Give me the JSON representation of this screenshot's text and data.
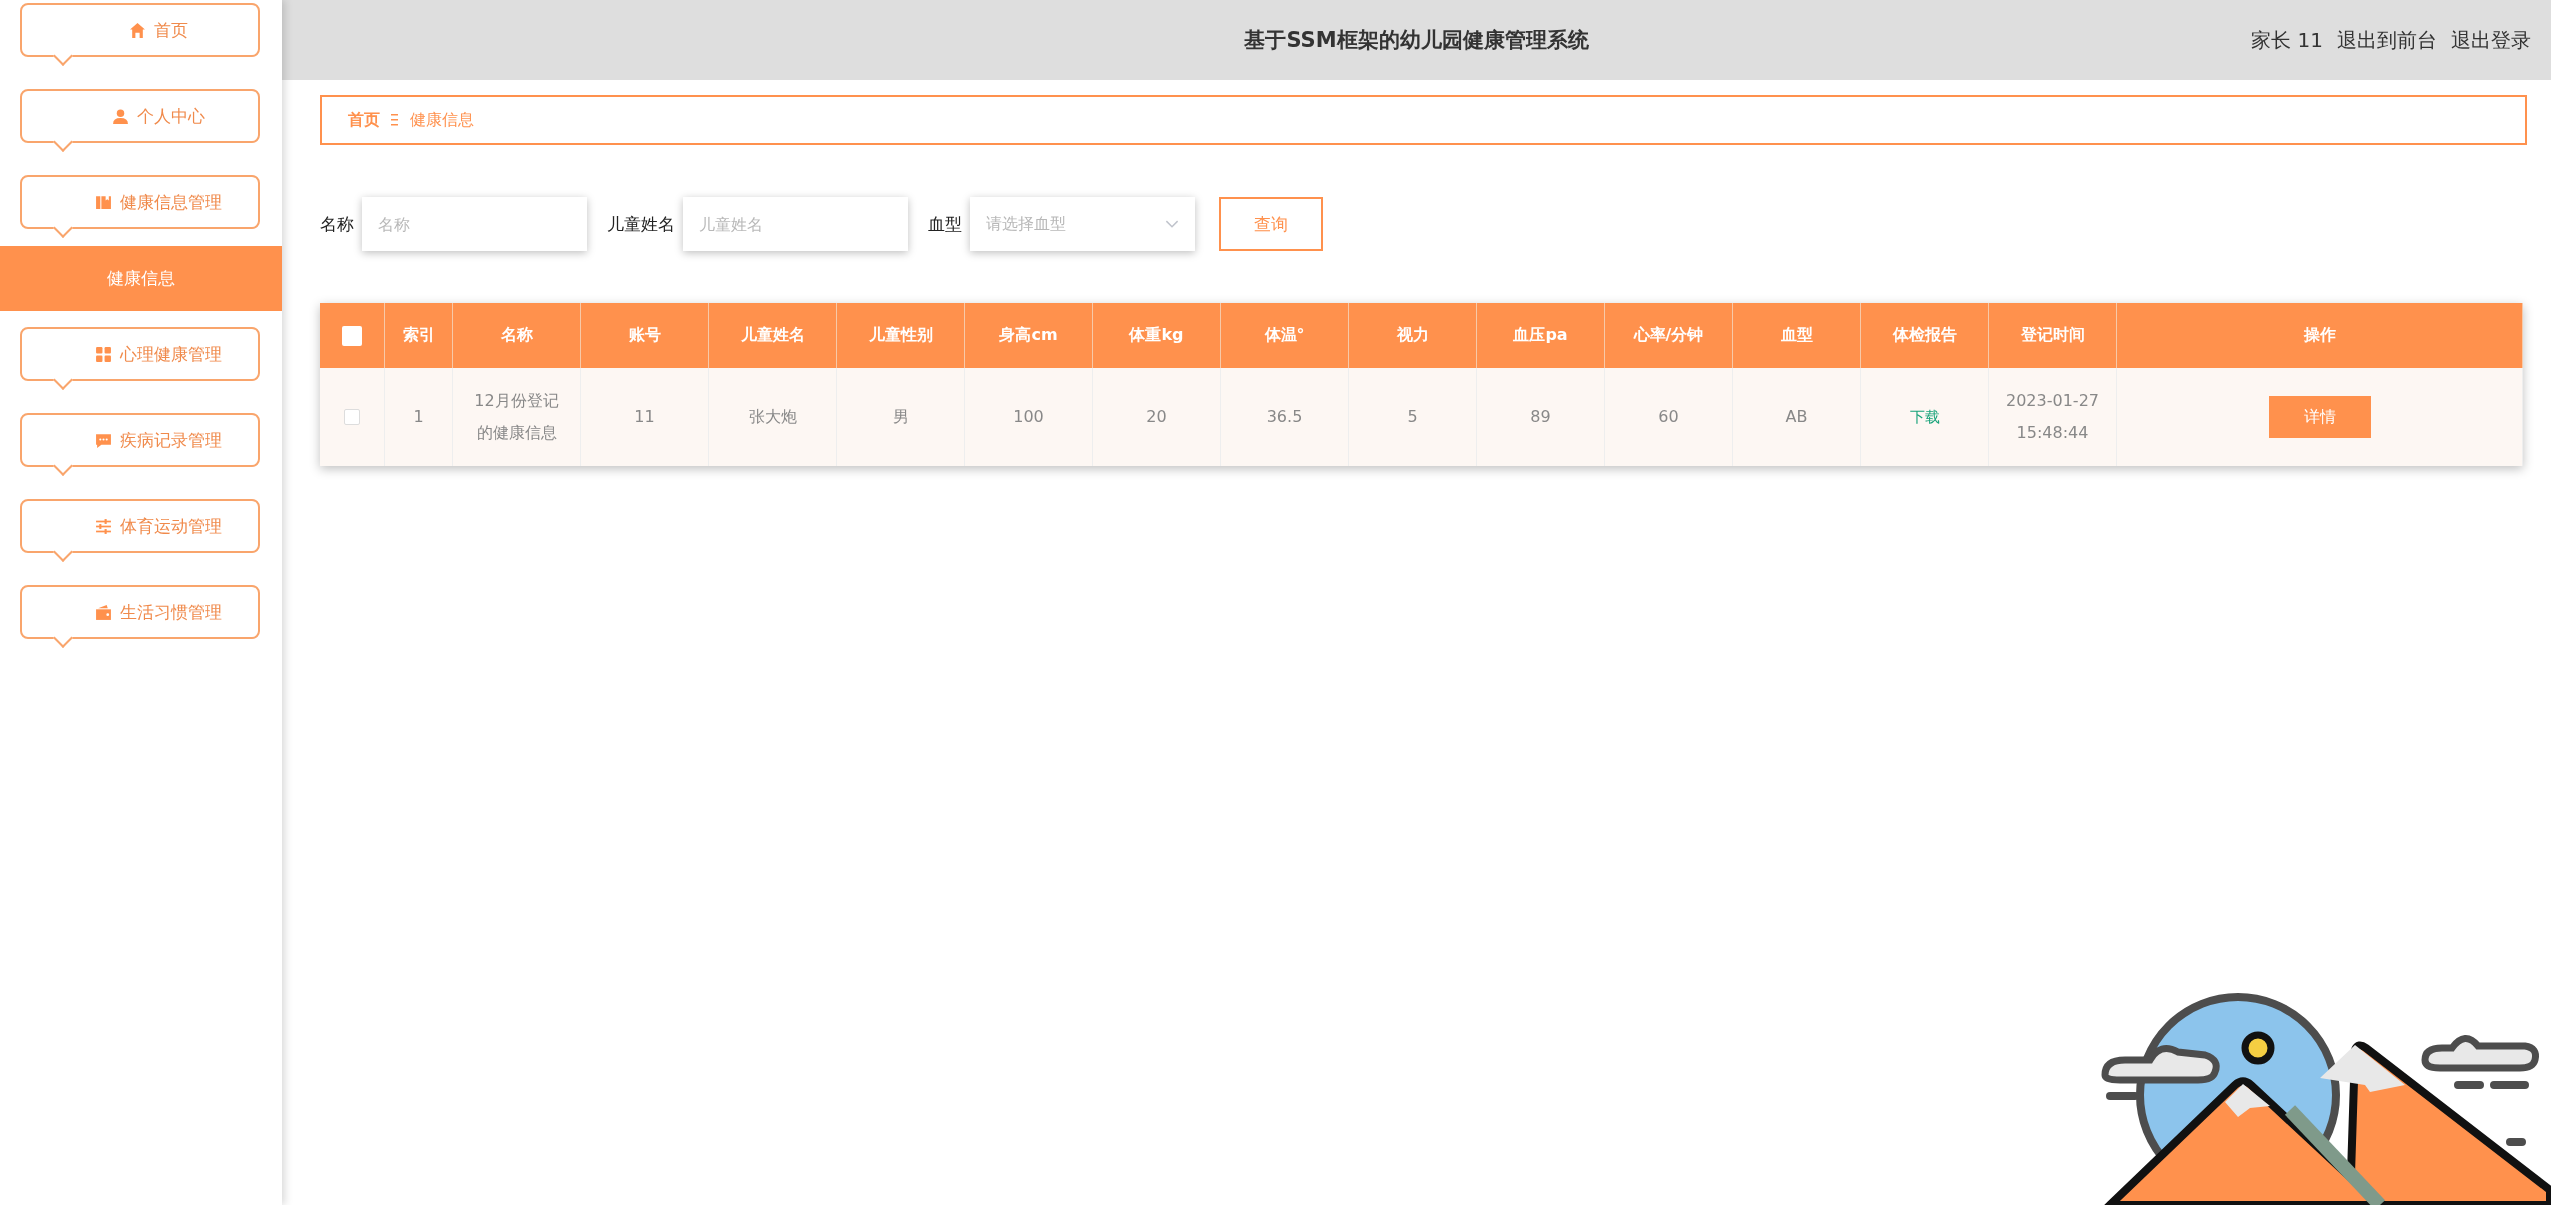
{
  "sidebar": {
    "items": [
      {
        "label": "首页",
        "kind": "menu",
        "selected": false
      },
      {
        "label": "个人中心",
        "kind": "menu",
        "selected": false
      },
      {
        "label": "健康信息管理",
        "kind": "menu",
        "selected": false
      },
      {
        "label": "健康信息",
        "kind": "sub",
        "selected": true
      },
      {
        "label": "心理健康管理",
        "kind": "menu",
        "selected": false
      },
      {
        "label": "疾病记录管理",
        "kind": "menu",
        "selected": false
      },
      {
        "label": "体育运动管理",
        "kind": "menu",
        "selected": false
      },
      {
        "label": "生活习惯管理",
        "kind": "menu",
        "selected": false
      }
    ]
  },
  "header": {
    "title": "基于SSM框架的幼儿园健康管理系统",
    "user": "家长 11",
    "links": [
      "退出到前台",
      "退出登录"
    ]
  },
  "breadcrumb": [
    "首页",
    "健康信息"
  ],
  "search": {
    "fields": [
      {
        "label": "名称",
        "placeholder": "名称",
        "kind": "text"
      },
      {
        "label": "儿童姓名",
        "placeholder": "儿童姓名",
        "kind": "text"
      },
      {
        "label": "血型",
        "placeholder": "请选择血型",
        "kind": "select"
      }
    ],
    "button": "查询"
  },
  "table": {
    "all_checked": false,
    "columns": [
      "索引",
      "名称",
      "账号",
      "儿童姓名",
      "儿童性别",
      "身高cm",
      "体重kg",
      "体温°",
      "视力",
      "血压pa",
      "心率/分钟",
      "血型",
      "体检报告",
      "登记时间",
      "操作"
    ],
    "rows": [
      {
        "checked": false,
        "cells": [
          {
            "text": "1",
            "kind": "text"
          },
          {
            "text": "12月份登记的健康信息",
            "kind": "text"
          },
          {
            "text": "11",
            "kind": "text"
          },
          {
            "text": "张大炮",
            "kind": "text"
          },
          {
            "text": "男",
            "kind": "text"
          },
          {
            "text": "100",
            "kind": "text"
          },
          {
            "text": "20",
            "kind": "text"
          },
          {
            "text": "36.5",
            "kind": "text"
          },
          {
            "text": "5",
            "kind": "text"
          },
          {
            "text": "89",
            "kind": "text"
          },
          {
            "text": "60",
            "kind": "text"
          },
          {
            "text": "AB",
            "kind": "text"
          },
          {
            "text": "下载",
            "kind": "link"
          },
          {
            "text": "2023-01-27 15:48:44",
            "kind": "text"
          },
          {
            "text": "详情",
            "kind": "button"
          }
        ]
      }
    ]
  }
}
